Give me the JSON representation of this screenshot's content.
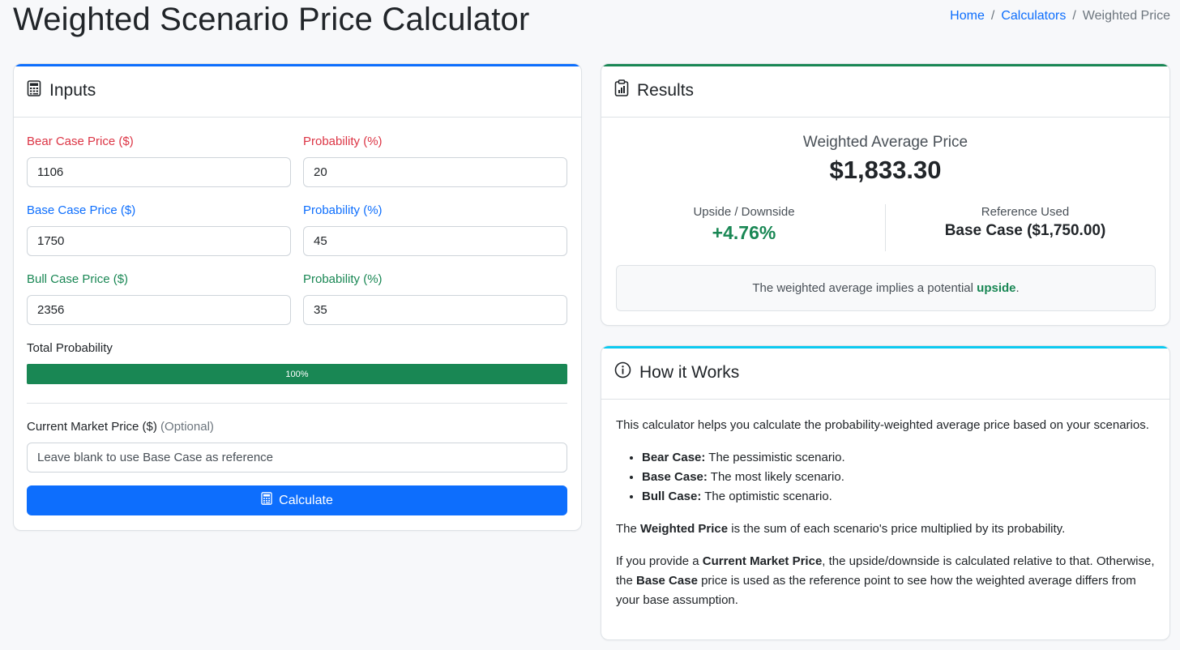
{
  "header": {
    "title": "Weighted Scenario Price Calculator",
    "breadcrumb": [
      "Home",
      "Calculators",
      "Weighted Price"
    ]
  },
  "inputs": {
    "title": "Inputs",
    "bear": {
      "label": "Bear Case Price ($)",
      "value": "1106",
      "prob_label": "Probability (%)",
      "prob_value": "20"
    },
    "base": {
      "label": "Base Case Price ($)",
      "value": "1750",
      "prob_label": "Probability (%)",
      "prob_value": "45"
    },
    "bull": {
      "label": "Bull Case Price ($)",
      "value": "2356",
      "prob_label": "Probability (%)",
      "prob_value": "35"
    },
    "total_label": "Total Probability",
    "total_text": "100%",
    "total_fraction": 1.0,
    "market_label": "Current Market Price ($)",
    "market_optional": "(Optional)",
    "market_placeholder": "Leave blank to use Base Case as reference",
    "market_value": "",
    "calculate_label": "Calculate"
  },
  "results": {
    "title": "Results",
    "weighted_label": "Weighted Average Price",
    "weighted_value": "$1,833.30",
    "updown_label": "Upside / Downside",
    "updown_value": "+4.76%",
    "reference_label": "Reference Used",
    "reference_value": "Base Case ($1,750.00)",
    "implication_prefix": "The weighted average implies a potential",
    "implication_word": "upside",
    "implication_suffix": "."
  },
  "how": {
    "title": "How it Works",
    "intro": "This calculator helps you calculate the probability-weighted average price based on your scenarios.",
    "bullets": [
      {
        "term": "Bear Case:",
        "desc": "The pessimistic scenario."
      },
      {
        "term": "Base Case:",
        "desc": "The most likely scenario."
      },
      {
        "term": "Bull Case:",
        "desc": "The optimistic scenario."
      }
    ],
    "p2_a": "The",
    "p2_b": "Weighted Price",
    "p2_c": "is the sum of each scenario's price multiplied by its probability.",
    "p3_a": "If you provide a",
    "p3_b": "Current Market Price",
    "p3_c": ", the upside/downside is calculated relative to that. Otherwise, the",
    "p3_d": "Base Case",
    "p3_e": "price is used as the reference point to see how the weighted average differs from your base assumption."
  },
  "colors": {
    "bear": "#dc3545",
    "base": "#0d6efd",
    "bull": "#198754",
    "results_accent": "#198754",
    "how_accent": "#0dcaf0",
    "inputs_accent": "#0d6efd"
  },
  "icons": {
    "inputs": "calculator-icon",
    "results": "clipboard-chart-icon",
    "how": "info-circle-icon",
    "calculate": "calculator-icon"
  }
}
